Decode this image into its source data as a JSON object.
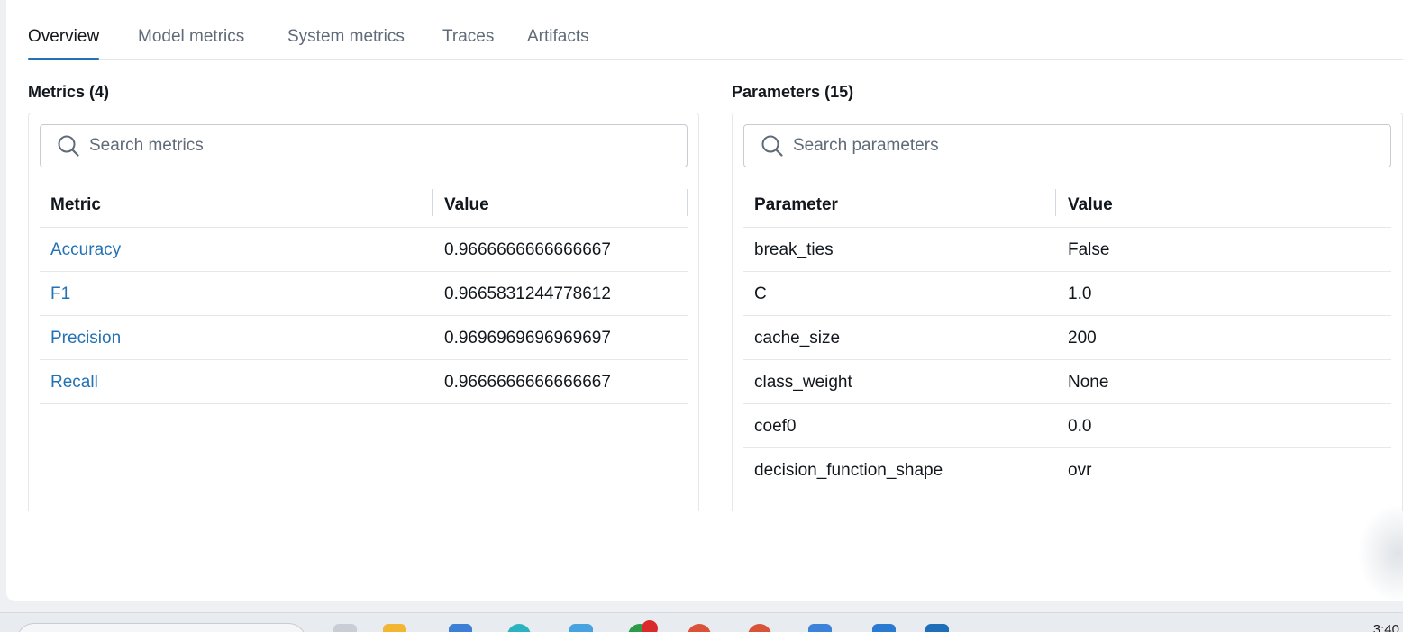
{
  "tabs": [
    {
      "label": "Overview",
      "active": true
    },
    {
      "label": "Model metrics",
      "active": false
    },
    {
      "label": "System metrics",
      "active": false
    },
    {
      "label": "Traces",
      "active": false
    },
    {
      "label": "Artifacts",
      "active": false
    }
  ],
  "metrics": {
    "title": "Metrics (4)",
    "search_placeholder": "Search metrics",
    "columns": [
      "Metric",
      "Value"
    ],
    "rows": [
      {
        "name": "Accuracy",
        "value": "0.9666666666666667"
      },
      {
        "name": "F1",
        "value": "0.9665831244778612"
      },
      {
        "name": "Precision",
        "value": "0.9696969696969697"
      },
      {
        "name": "Recall",
        "value": "0.9666666666666667"
      }
    ]
  },
  "parameters": {
    "title": "Parameters (15)",
    "search_placeholder": "Search parameters",
    "columns": [
      "Parameter",
      "Value"
    ],
    "rows": [
      {
        "name": "break_ties",
        "value": "False"
      },
      {
        "name": "C",
        "value": "1.0"
      },
      {
        "name": "cache_size",
        "value": "200"
      },
      {
        "name": "class_weight",
        "value": "None"
      },
      {
        "name": "coef0",
        "value": "0.0"
      },
      {
        "name": "decision_function_shape",
        "value": "ovr"
      }
    ]
  },
  "taskbar": {
    "clock": "3:40",
    "icons": [
      "file-explorer-icon",
      "folder-icon",
      "store-icon",
      "edge-icon",
      "mail-icon",
      "chrome-icon",
      "avatar-icon",
      "avatar-icon",
      "monitor-icon",
      "vscode-icon",
      "app-icon"
    ]
  },
  "colors": {
    "accent": "#2272b4",
    "text": "#11171c",
    "muted": "#5f6b78"
  }
}
